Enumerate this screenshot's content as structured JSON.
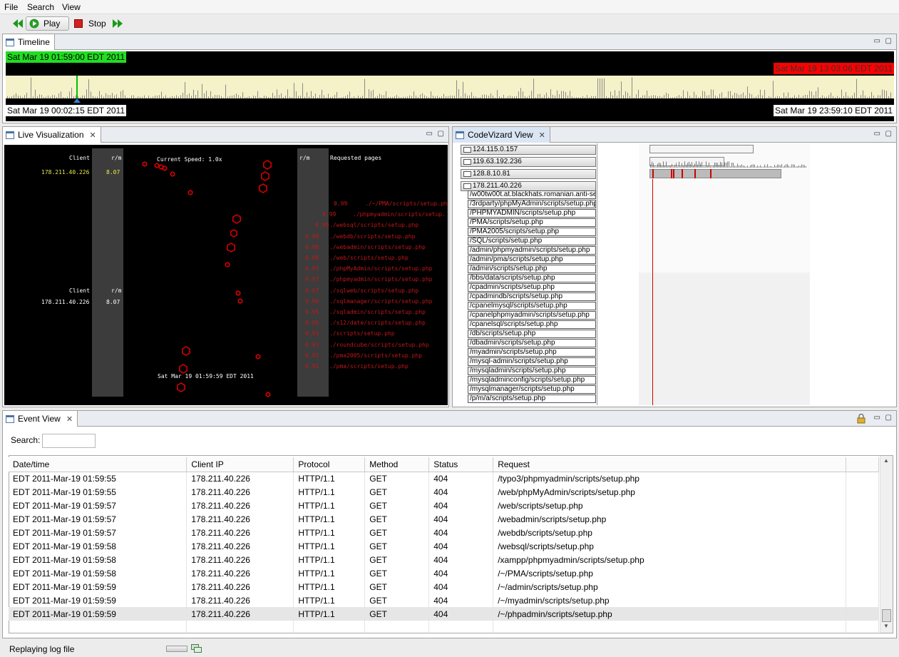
{
  "menu": {
    "items": [
      "File",
      "Search",
      "View"
    ]
  },
  "toolbar": {
    "play_label": "Play",
    "stop_label": "Stop"
  },
  "timeline": {
    "title": "Timeline",
    "range_start": "Sat Mar 19 01:59:00 EDT 2011",
    "range_end": "Sat Mar 19 13:03:06 EDT 2011",
    "day_start": "Sat Mar 19 00:02:15 EDT 2011",
    "day_end": "Sat Mar 19 23:59:10 EDT 2011"
  },
  "live": {
    "title": "Live Visualization",
    "col_client": "Client",
    "col_rm": "r/m",
    "col_rm2": "r/m",
    "col_pages": "Requested pages",
    "speed": "Current Speed: 1.0x",
    "clients": [
      {
        "ip": "178.211.40.226",
        "rm": "8.07"
      }
    ],
    "clients2": [
      {
        "ip": "178.211.40.226",
        "rm": "8.07"
      }
    ],
    "timestamp": "Sat Mar 19 01:59:59 EDT 2011",
    "pages": [
      {
        "rm": "0.99",
        "path": "./~/PMA/scripts/setup.ph"
      },
      {
        "rm": "0.99",
        "path": "./phpmyadmin/scripts/setup."
      },
      {
        "rm": "0.99",
        "path": "./websql/scripts/setup.php"
      },
      {
        "rm": "0.99",
        "path": "./webdb/scripts/setup.php"
      },
      {
        "rm": "0.98",
        "path": "./webadmin/scripts/setup.php"
      },
      {
        "rm": "0.98",
        "path": "./web/scripts/setup.php"
      },
      {
        "rm": "0.97",
        "path": "./phpMyAdmin/scripts/setup.php"
      },
      {
        "rm": "0.97",
        "path": "./phpmyadmin/scripts/setup.php"
      },
      {
        "rm": "0.97",
        "path": "./sqlweb/scripts/setup.php"
      },
      {
        "rm": "0.96",
        "path": "./sqlmanager/scripts/setup.php"
      },
      {
        "rm": "0.95",
        "path": "./sqladmin/scripts/setup.php"
      },
      {
        "rm": "0.95",
        "path": "./s12/date/scripts/setup.php"
      },
      {
        "rm": "0.93",
        "path": "./scripts/setup.php"
      },
      {
        "rm": "0.93",
        "path": "./roundcube/scripts/setup.php"
      },
      {
        "rm": "0.92",
        "path": "./pma2005/scripts/setup.php"
      },
      {
        "rm": "0.91",
        "path": "./pma/scripts/setup.php"
      }
    ]
  },
  "codewizard": {
    "title": "CodeVizard View",
    "folders": [
      "124.115.0.157",
      "119.63.192.236",
      "128.8.10.81",
      "178.211.40.226"
    ],
    "files": [
      "/w00tw00t.at.blackhats.romanian.anti-se",
      "/3rdparty/phpMyAdmin/scripts/setup.php",
      "/PHPMYADMIN/scripts/setup.php",
      "/PMA/scripts/setup.php",
      "/PMA2005/scripts/setup.php",
      "/SQL/scripts/setup.php",
      "/admin/phpmyadmin/scripts/setup.php",
      "/admin/pma/scripts/setup.php",
      "/admin/scripts/setup.php",
      "/bbs/data/scripts/setup.php",
      "/cpadmin/scripts/setup.php",
      "/cpadmindb/scripts/setup.php",
      "/cpanelmysql/scripts/setup.php",
      "/cpanelphpmyadmin/scripts/setup.php",
      "/cpanelsql/scripts/setup.php",
      "/db/scripts/setup.php",
      "/dbadmin/scripts/setup.php",
      "/myadmin/scripts/setup.php",
      "/mysql-admin/scripts/setup.php",
      "/mysqladmin/scripts/setup.php",
      "/mysqladminconfig/scripts/setup.php",
      "/mysqlmanager/scripts/setup.php",
      "/p/m/a/scripts/setup.php"
    ]
  },
  "events": {
    "title": "Event View",
    "search_label": "Search:",
    "search_value": "",
    "columns": [
      "Date/time",
      "Client IP",
      "Protocol",
      "Method",
      "Status",
      "Request"
    ],
    "rows": [
      [
        "EDT 2011-Mar-19 01:59:55",
        "178.211.40.226",
        "HTTP/1.1",
        "GET",
        "404",
        "/typo3/phpmyadmin/scripts/setup.php"
      ],
      [
        "EDT 2011-Mar-19 01:59:55",
        "178.211.40.226",
        "HTTP/1.1",
        "GET",
        "404",
        "/web/phpMyAdmin/scripts/setup.php"
      ],
      [
        "EDT 2011-Mar-19 01:59:57",
        "178.211.40.226",
        "HTTP/1.1",
        "GET",
        "404",
        "/web/scripts/setup.php"
      ],
      [
        "EDT 2011-Mar-19 01:59:57",
        "178.211.40.226",
        "HTTP/1.1",
        "GET",
        "404",
        "/webadmin/scripts/setup.php"
      ],
      [
        "EDT 2011-Mar-19 01:59:57",
        "178.211.40.226",
        "HTTP/1.1",
        "GET",
        "404",
        "/webdb/scripts/setup.php"
      ],
      [
        "EDT 2011-Mar-19 01:59:58",
        "178.211.40.226",
        "HTTP/1.1",
        "GET",
        "404",
        "/websql/scripts/setup.php"
      ],
      [
        "EDT 2011-Mar-19 01:59:58",
        "178.211.40.226",
        "HTTP/1.1",
        "GET",
        "404",
        "/xampp/phpmyadmin/scripts/setup.php"
      ],
      [
        "EDT 2011-Mar-19 01:59:58",
        "178.211.40.226",
        "HTTP/1.1",
        "GET",
        "404",
        "/~/PMA/scripts/setup.php"
      ],
      [
        "EDT 2011-Mar-19 01:59:59",
        "178.211.40.226",
        "HTTP/1.1",
        "GET",
        "404",
        "/~/admin/scripts/setup.php"
      ],
      [
        "EDT 2011-Mar-19 01:59:59",
        "178.211.40.226",
        "HTTP/1.1",
        "GET",
        "404",
        "/~/myadmin/scripts/setup.php"
      ],
      [
        "EDT 2011-Mar-19 01:59:59",
        "178.211.40.226",
        "HTTP/1.1",
        "GET",
        "404",
        "/~/phpadmin/scripts/setup.php"
      ]
    ]
  },
  "status": {
    "text": "Replaying log file"
  },
  "colors": {
    "accent_green": "#00c000",
    "accent_red": "#e00000",
    "timeline_bg": "#f5f1c8"
  }
}
